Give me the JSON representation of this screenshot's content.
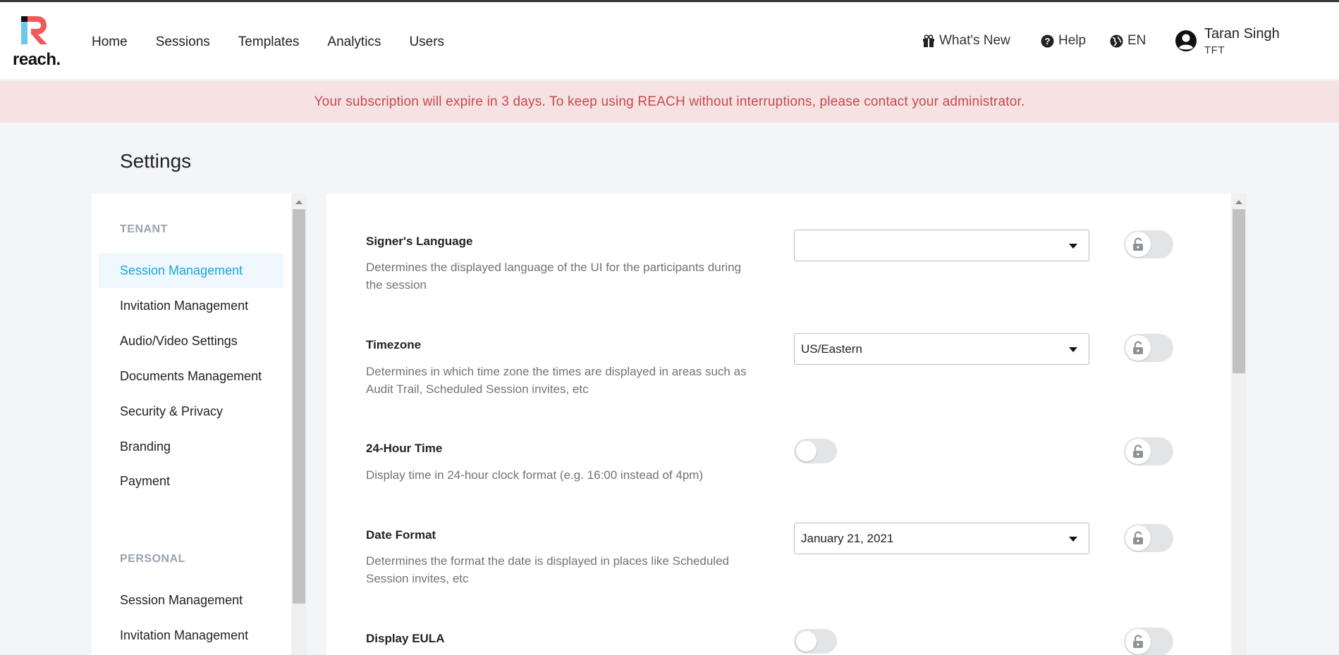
{
  "app": {
    "logo_text": "reach.",
    "colors": {
      "brand_red": "#f25a5a",
      "brand_blue": "#6ec8ee",
      "accent": "#1aa5dc",
      "banner_bg": "#f6e2e3",
      "banner_text": "#c54a4f"
    }
  },
  "nav": {
    "items": [
      {
        "label": "Home"
      },
      {
        "label": "Sessions"
      },
      {
        "label": "Templates"
      },
      {
        "label": "Analytics"
      },
      {
        "label": "Users"
      }
    ]
  },
  "right_nav": {
    "whats_new": {
      "label": "What's New",
      "icon": "gift-icon"
    },
    "help": {
      "label": "Help",
      "icon": "question-circle-icon"
    },
    "language": {
      "label": "EN",
      "icon": "globe-icon"
    }
  },
  "user": {
    "name": "Taran Singh",
    "org": "TFT",
    "icon": "user-circle-icon"
  },
  "banner": {
    "text": "Your subscription will expire in 3 days. To keep using REACH without interruptions, please contact your administrator."
  },
  "page": {
    "title": "Settings"
  },
  "sidebar": {
    "tenant_heading": "TENANT",
    "tenant_items": [
      {
        "label": "Session Management",
        "active": true
      },
      {
        "label": "Invitation Management"
      },
      {
        "label": "Audio/Video Settings"
      },
      {
        "label": "Documents Management"
      },
      {
        "label": "Security & Privacy"
      },
      {
        "label": "Branding"
      },
      {
        "label": "Payment"
      }
    ],
    "personal_heading": "PERSONAL",
    "personal_items": [
      {
        "label": "Session Management"
      },
      {
        "label": "Invitation Management"
      }
    ]
  },
  "settings": [
    {
      "title": "Signer's Language",
      "description": "Determines the displayed language of the UI for the participants during the session",
      "control": "select",
      "value": ""
    },
    {
      "title": "Timezone",
      "description": "Determines in which time zone the times are displayed in areas such as Audit Trail, Scheduled Session invites, etc",
      "control": "select",
      "value": "US/Eastern"
    },
    {
      "title": "24-Hour Time",
      "description": "Display time in 24-hour clock format (e.g. 16:00 instead of 4pm)",
      "control": "toggle",
      "value": "off"
    },
    {
      "title": "Date Format",
      "description": "Determines the format the date is displayed in places like Scheduled Session invites, etc",
      "control": "select",
      "value": "January 21, 2021"
    },
    {
      "title": "Display EULA",
      "description": "",
      "control": "toggle",
      "value": "off"
    }
  ]
}
